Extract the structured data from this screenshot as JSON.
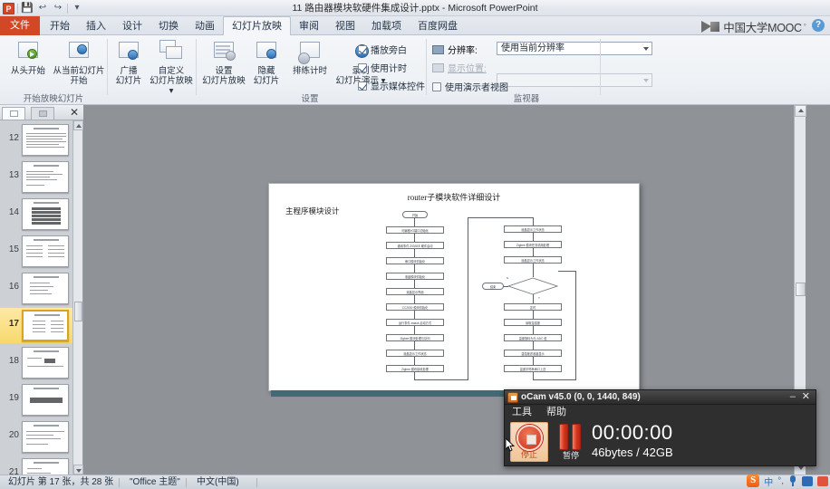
{
  "window": {
    "title": "11 路由器模块软硬件集成设计.pptx - Microsoft PowerPoint",
    "app_badge": "P",
    "minimize": "–",
    "restore": "❐",
    "close": "✕"
  },
  "quick_access": {
    "save": "💾",
    "undo": "↩",
    "redo": "↪",
    "customize": "▾"
  },
  "ribbon_tabs": [
    {
      "label": "文件",
      "type": "file"
    },
    {
      "label": "开始",
      "type": "normal"
    },
    {
      "label": "插入",
      "type": "normal"
    },
    {
      "label": "设计",
      "type": "normal"
    },
    {
      "label": "切换",
      "type": "normal"
    },
    {
      "label": "动画",
      "type": "normal"
    },
    {
      "label": "幻灯片放映",
      "type": "active"
    },
    {
      "label": "审阅",
      "type": "normal"
    },
    {
      "label": "视图",
      "type": "normal"
    },
    {
      "label": "加载项",
      "type": "normal"
    },
    {
      "label": "百度网盘",
      "type": "normal"
    }
  ],
  "branding": {
    "mooc_text": "中国大学MOOC",
    "mooc_dot": "°",
    "help": "?"
  },
  "ribbon": {
    "groups": [
      {
        "name": "开始放映幻灯片",
        "label": "开始放映幻灯片"
      },
      {
        "name": "设置",
        "label": "设置"
      },
      {
        "name": "监视器",
        "label": "监视器"
      }
    ],
    "buttons": {
      "from_beginning": "从头开始",
      "from_current_l1": "从当前幻灯片",
      "from_current_l2": "开始",
      "broadcast_l1": "广播",
      "broadcast_l2": "幻灯片",
      "custom_l1": "自定义",
      "custom_l2": "幻灯片放映 ▾",
      "setup_l1": "设置",
      "setup_l2": "幻灯片放映",
      "hide_l1": "隐藏",
      "hide_l2": "幻灯片",
      "rehearse_l1": "排练计时",
      "record_l1": "录制",
      "record_l2": "幻灯片演示 ▾"
    },
    "checkboxes": [
      {
        "label": "播放旁白",
        "checked": true
      },
      {
        "label": "使用计时",
        "checked": true
      },
      {
        "label": "显示媒体控件",
        "checked": true
      }
    ],
    "monitor": {
      "resolution_label": "分辨率:",
      "resolution_value": "使用当前分辨率",
      "display_label": "显示位置:",
      "display_value": "",
      "presenter_view": "使用演示者视图",
      "presenter_checked": false
    }
  },
  "slide_panel": {
    "close": "✕",
    "thumbnails": [
      {
        "number": "12",
        "selected": false
      },
      {
        "number": "13",
        "selected": false
      },
      {
        "number": "14",
        "selected": false
      },
      {
        "number": "15",
        "selected": false
      },
      {
        "number": "16",
        "selected": false
      },
      {
        "number": "17",
        "selected": true
      },
      {
        "number": "18",
        "selected": false
      },
      {
        "number": "19",
        "selected": false
      },
      {
        "number": "20",
        "selected": false
      },
      {
        "number": "21",
        "selected": false
      }
    ]
  },
  "slide": {
    "title": "router子模块软件详细设计",
    "subtitle": "主程序模块设计",
    "flowchart": {
      "left_column": [
        "开始",
        "可编程I/O端口初始化",
        "通用事件 ZIGBEE 硬件启动",
        "串口模块初始化",
        "液晶模块初始化",
        "液晶显示界面",
        "CC2530 模块初始化",
        "运行事件 zstack 启动方式",
        "Zigbee 模块处理与队列",
        "液晶显示工作状态",
        "Zigbee 模块接收处理"
      ],
      "right_column": [
        "液晶显示工作状态",
        "Zigbee 模块任务调用处理",
        "液晶显示工作状态",
        "定时",
        "读取温湿度",
        "温度指标为与 ADC 值",
        "温湿度送液晶显示",
        "温度字符串串口上送"
      ],
      "decision": "?",
      "decision_no_label": "N",
      "decision_yes_label": "Y",
      "decision_branch": "结束"
    }
  },
  "status_bar": {
    "slide_count": "幻灯片 第 17 张，共 28 张",
    "theme": "\"Office 主题\"",
    "language": "中文(中国)"
  },
  "ime": {
    "logo": "S",
    "mode": "中",
    "punctuation": "°,",
    "mic": "mic",
    "keyboard": "kbd",
    "toolbox": "box"
  },
  "ocam": {
    "title": "oCam v45.0 (0, 0, 1440, 849)",
    "minimize": "–",
    "close": "✕",
    "menu": [
      "工具",
      "帮助"
    ],
    "stop_label": "停止",
    "pause_label": "暂停",
    "time": "00:00:00",
    "size": "46bytes / 42GB"
  }
}
